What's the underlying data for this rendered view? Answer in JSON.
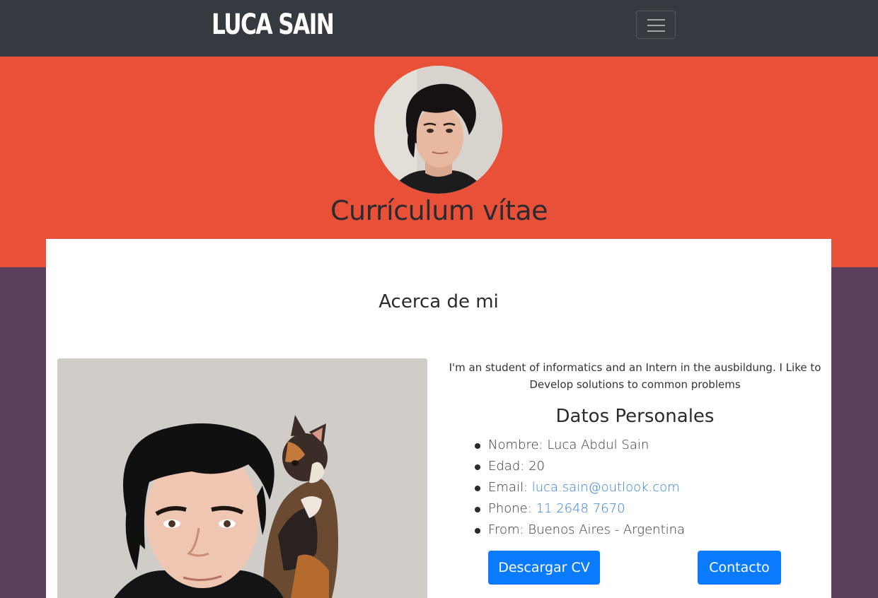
{
  "navbar": {
    "brand": "LUCA SAIN",
    "toggler_icon": "hamburger-menu-icon"
  },
  "hero": {
    "title": "Currículum vítae",
    "avatar_alt": "Luca Sain profile photo"
  },
  "about": {
    "title": "Acerca de mi",
    "intro": "I'm an student of informatics and an Intern in the ausbildung. I Like to Develop solutions to common problems",
    "photo_alt": "Luca with a cat on his shoulder"
  },
  "personal": {
    "title": "Datos Personales",
    "items": [
      {
        "label": "Nombre:",
        "value": "Luca Abdul Sain"
      },
      {
        "label": "Edad:",
        "value": "20"
      },
      {
        "label": "Email:",
        "value": "luca.sain@outlook.com"
      },
      {
        "label": "Phone:",
        "value": "11 2648 7670"
      },
      {
        "label": "From:",
        "value": "Buenos Aires - Argentina"
      }
    ]
  },
  "buttons": {
    "download_cv": "Descargar CV",
    "contact": "Contacto"
  },
  "colors": {
    "navbar": "#343a40",
    "hero": "#e85038",
    "lower_bg": "#5b405e",
    "button": "#0a7bff",
    "link": "#2f7fe0"
  }
}
